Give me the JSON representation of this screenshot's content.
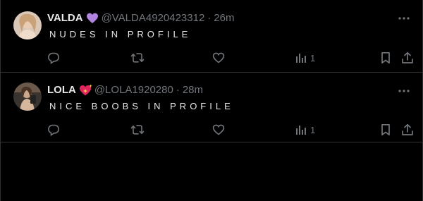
{
  "tweets": [
    {
      "display_name": "VALDA",
      "badge_icon": "purple-heart-icon",
      "badge_color": "#b084e0",
      "handle": "@VALDA4920423312",
      "separator": "·",
      "time": "26m",
      "text": "NUDES IN PROFILE",
      "views": "1"
    },
    {
      "display_name": "LOLA",
      "badge_icon": "sparkling-heart-icon",
      "badge_color": "#e0245e",
      "handle": "@LOLA1920280",
      "separator": "·",
      "time": "28m",
      "text": "NICE BOOBS IN PROFILE",
      "views": "1"
    }
  ],
  "icons": {
    "more": "more-horizontal-icon",
    "reply": "reply-icon",
    "retweet": "retweet-icon",
    "like": "heart-icon",
    "views": "views-icon",
    "bookmark": "bookmark-icon",
    "share": "share-icon"
  },
  "colors": {
    "background": "#000000",
    "border": "#2f3336",
    "primary_text": "#e7e9ea",
    "secondary_text": "#71767b"
  }
}
